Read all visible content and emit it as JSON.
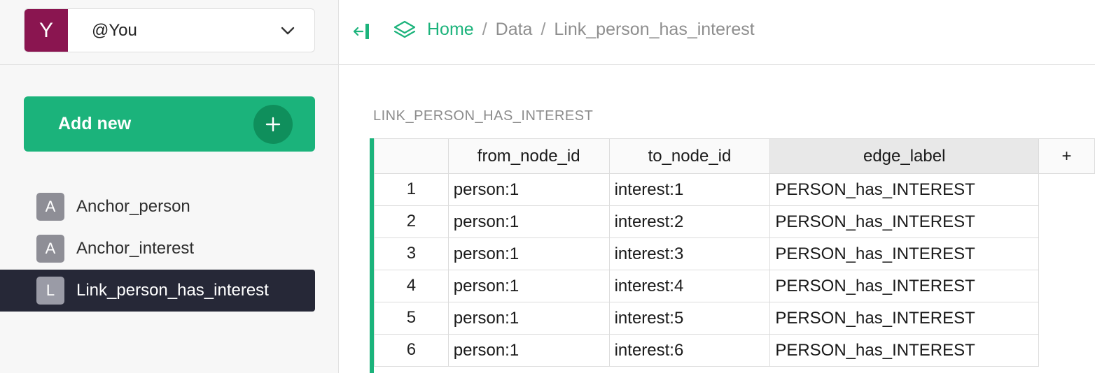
{
  "user": {
    "avatar_letter": "Y",
    "name": "@You"
  },
  "sidebar": {
    "add_new_label": "Add new",
    "items": [
      {
        "badge": "A",
        "label": "Anchor_person",
        "active": false
      },
      {
        "badge": "A",
        "label": "Anchor_interest",
        "active": false
      },
      {
        "badge": "L",
        "label": "Link_person_has_interest",
        "active": true
      }
    ]
  },
  "breadcrumb": {
    "home": "Home",
    "sep": "/",
    "data": "Data",
    "current": "Link_person_has_interest"
  },
  "main": {
    "section_title": "LINK_PERSON_HAS_INTEREST",
    "table": {
      "columns": [
        "from_node_id",
        "to_node_id",
        "edge_label"
      ],
      "add_column_label": "+",
      "selected_column": "edge_label",
      "rows": [
        {
          "num": "1",
          "from": "person:1",
          "to": "interest:1",
          "edge": "PERSON_has_INTEREST"
        },
        {
          "num": "2",
          "from": "person:1",
          "to": "interest:2",
          "edge": "PERSON_has_INTEREST"
        },
        {
          "num": "3",
          "from": "person:1",
          "to": "interest:3",
          "edge": "PERSON_has_INTEREST"
        },
        {
          "num": "4",
          "from": "person:1",
          "to": "interest:4",
          "edge": "PERSON_has_INTEREST"
        },
        {
          "num": "5",
          "from": "person:1",
          "to": "interest:5",
          "edge": "PERSON_has_INTEREST"
        },
        {
          "num": "6",
          "from": "person:1",
          "to": "interest:6",
          "edge": "PERSON_has_INTEREST"
        }
      ]
    }
  },
  "colors": {
    "accent": "#1bb37b",
    "avatar": "#8a1550",
    "active_nav": "#262837"
  }
}
